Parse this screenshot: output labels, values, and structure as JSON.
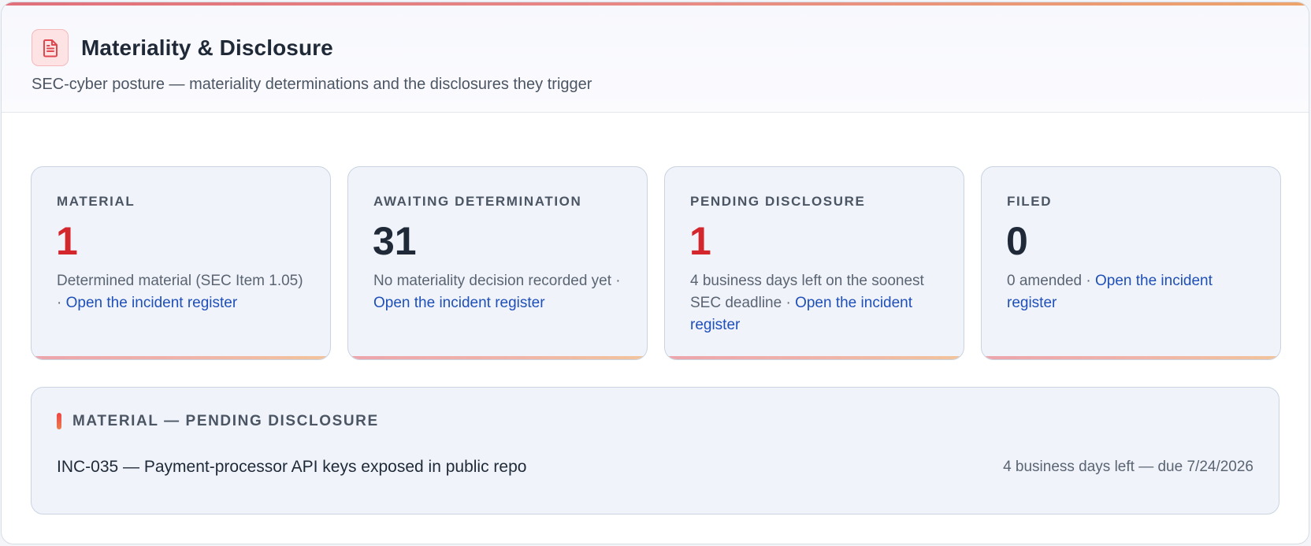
{
  "header": {
    "title": "Materiality & Disclosure",
    "subtitle": "SEC-cyber posture — materiality determinations and the disclosures they trigger",
    "icon": "document-icon"
  },
  "colors": {
    "critical_red": "#d3262d",
    "link_blue": "#1f4fb8",
    "accent_gradient": [
      "#e0707a",
      "#eda46a"
    ]
  },
  "cards": [
    {
      "label": "MATERIAL",
      "value": "1",
      "desc": "Determined material (SEC Item 1.05) · ",
      "link": "Open the incident register"
    },
    {
      "label": "AWAITING DETERMINATION",
      "value": "31",
      "desc": "No materiality decision recorded yet · ",
      "link": "Open the incident register"
    },
    {
      "label": "PENDING DISCLOSURE",
      "value": "1",
      "desc": "4 business days left on the soonest SEC deadline · ",
      "link": "Open the incident register"
    },
    {
      "label": "FILED",
      "value": "0",
      "desc": "0 amended · ",
      "link": "Open the incident register"
    }
  ],
  "pending_section": {
    "title": "MATERIAL — PENDING DISCLOSURE",
    "rows": [
      {
        "text": "INC-035 — Payment-processor API keys exposed in public repo",
        "meta": "4 business days left — due 7/24/2026"
      }
    ]
  }
}
